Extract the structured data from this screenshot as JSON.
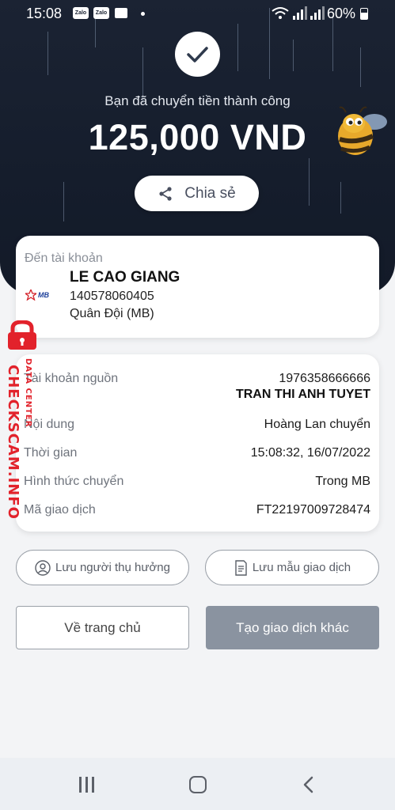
{
  "status_bar": {
    "time": "15:08",
    "notif_1": "Zalo",
    "notif_2": "Zalo",
    "battery": "60%"
  },
  "header": {
    "success_message": "Bạn đã chuyển tiền thành công",
    "amount": "125,000 VND",
    "share_label": "Chia sẻ"
  },
  "recipient": {
    "label": "Đến tài khoản",
    "bank_logo_text": "MB",
    "name": "LE CAO GIANG",
    "account_number": "140578060405",
    "bank_name": "Quân Đội (MB)"
  },
  "details": [
    {
      "key": "Tài khoản nguồn",
      "value": "1976358666666",
      "value2": "TRAN THI ANH TUYET"
    },
    {
      "key": "Nội dung",
      "value": "Hoàng Lan chuyển"
    },
    {
      "key": "Thời gian",
      "value": "15:08:32, 16/07/2022"
    },
    {
      "key": "Hình thức chuyển",
      "value": "Trong MB"
    },
    {
      "key": "Mã giao dịch",
      "value": "FT22197009728474"
    }
  ],
  "actions": {
    "save_recipient": "Lưu người thụ hưởng",
    "save_template": "Lưu mẫu giao dịch",
    "go_home": "Về trang chủ",
    "new_transaction": "Tạo giao dịch khác"
  },
  "watermark": {
    "main": "CHECKSCAM.INFO",
    "sub": "DATA CENTER"
  },
  "colors": {
    "header_bg": "#1b2333",
    "primary_button_disabled": "#8a93a0",
    "watermark_red": "#e2222b"
  }
}
